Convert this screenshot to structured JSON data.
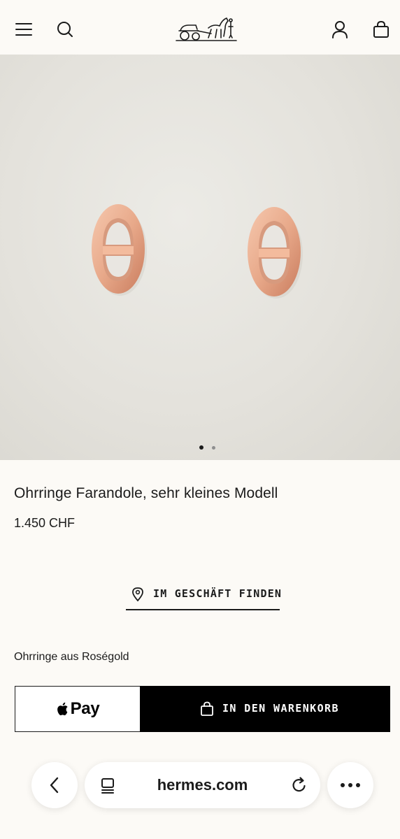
{
  "header": {
    "menu_icon": "hamburger-menu-icon",
    "search_icon": "search-icon",
    "logo": "hermes-carriage-logo",
    "account_icon": "user-icon",
    "bag_icon": "shopping-bag-icon"
  },
  "gallery": {
    "image": "rose-gold-farandole-earrings",
    "total_slides": 2,
    "active_slide": 1
  },
  "product": {
    "title": "Ohrringe Farandole, sehr kleines Modell",
    "price": "1.450 CHF",
    "find_in_store_label": "IM GESCHÄFT FINDEN",
    "description": "Ohrringe aus Roségold",
    "apple_pay_label": "Pay",
    "add_to_cart_label": "IN DEN WARENKORB"
  },
  "browser": {
    "domain": "hermes.com"
  },
  "colors": {
    "background": "#fcfaf6",
    "primary_button": "#000000",
    "text": "#1b1b1b",
    "rose_gold": "#e8a98a"
  }
}
